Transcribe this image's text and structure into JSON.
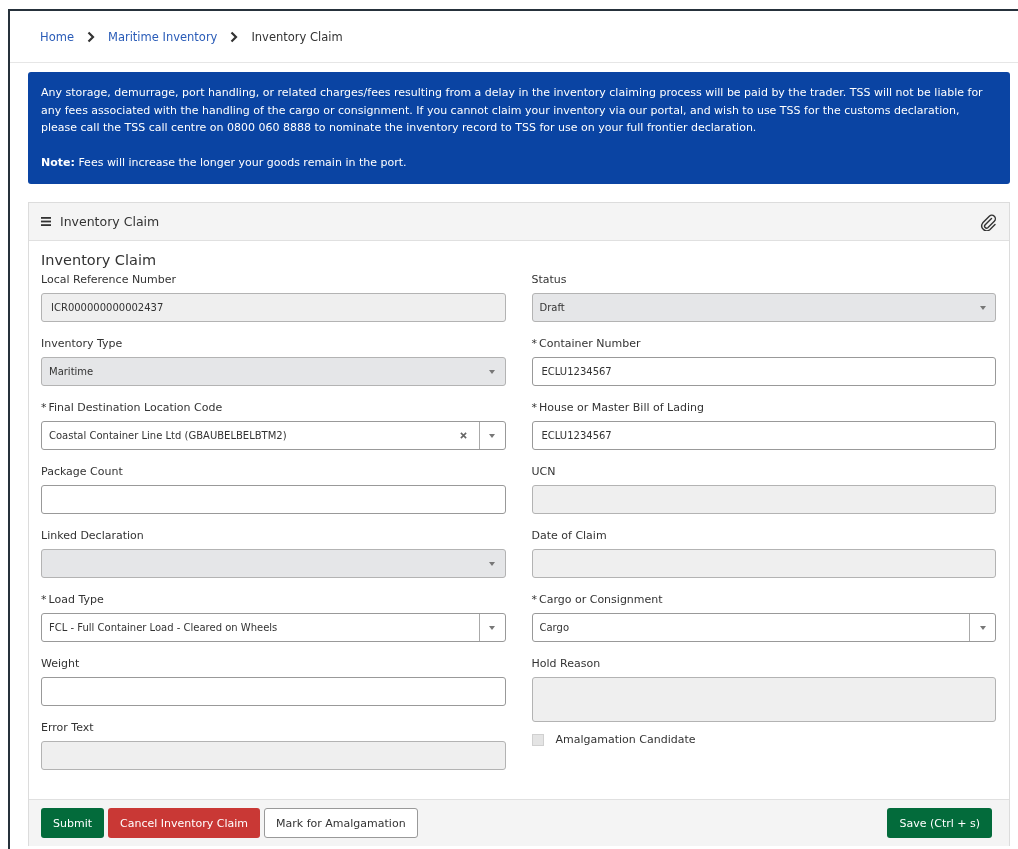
{
  "breadcrumb": [
    {
      "label": "Home",
      "kind": "link"
    },
    {
      "label": "Maritime Inventory",
      "kind": "link"
    },
    {
      "label": "Inventory Claim",
      "kind": "current"
    }
  ],
  "notice": [
    "Any storage, demurrage, port handling, or related charges/fees resulting from a delay in the inventory claiming process will be paid by the trader. TSS will not be liable for any fees associated with the handling of the cargo or consignment. If you cannot claim your inventory via our portal, and wish to use TSS for the customs declaration, please call the TSS call centre on 0800 060 8888 to nominate the inventory record to TSS for use on your full frontier declaration.",
    "**Note:** Fees will increase the longer your goods remain in the port."
  ],
  "panel": {
    "title": "Inventory Claim",
    "form_title": "Inventory Claim",
    "left_fields": [
      {
        "kind": "text",
        "label": "Local Reference Number",
        "value": "ICR000000000002437",
        "disabled": true
      },
      {
        "kind": "select",
        "label": "Inventory Type",
        "value": "Maritime",
        "disabled": true
      },
      {
        "kind": "combo",
        "required_mark": "*",
        "label": "Final Destination Location Code",
        "value": "Coastal Container Line Ltd (GBAUBELBELBTM2)",
        "disabled": false
      },
      {
        "kind": "text",
        "label": "Package Count",
        "disabled": false
      },
      {
        "kind": "select",
        "label": "Linked Declaration",
        "disabled": true
      },
      {
        "kind": "select",
        "required_mark": "*",
        "label": "Load Type",
        "value": "FCL - Full Container Load - Cleared on Wheels",
        "disabled": false
      },
      {
        "kind": "text",
        "label": "Weight",
        "disabled": false
      },
      {
        "kind": "text",
        "label": "Error Text",
        "disabled": true
      }
    ],
    "right_fields": [
      {
        "kind": "select",
        "label": "Status",
        "value": "Draft",
        "disabled": true
      },
      {
        "kind": "text",
        "required_mark": "*",
        "label": "Container Number",
        "value": "ECLU1234567",
        "disabled": false
      },
      {
        "kind": "text",
        "required_mark": "*",
        "label": "House or Master Bill of Lading",
        "value": "ECLU1234567",
        "disabled": false
      },
      {
        "kind": "text",
        "label": "UCN",
        "disabled": true
      },
      {
        "kind": "text",
        "label": "Date of Claim",
        "disabled": true
      },
      {
        "kind": "select",
        "required_mark": "*",
        "label": "Cargo or Consignment",
        "value": "Cargo",
        "disabled": false
      },
      {
        "kind": "textarea",
        "label": "Hold Reason",
        "disabled": true
      },
      {
        "kind": "checkbox",
        "label": "Amalgamation Candidate",
        "checked": false,
        "disabled": true
      }
    ]
  },
  "footer": {
    "left_buttons": [
      {
        "label": "Submit",
        "kind": "primary"
      },
      {
        "label": "Cancel Inventory Claim",
        "kind": "danger"
      },
      {
        "label": "Mark for Amalgamation",
        "kind": "default"
      }
    ],
    "right_buttons": [
      {
        "label": "Save (Ctrl + s)",
        "kind": "primary"
      }
    ]
  }
}
